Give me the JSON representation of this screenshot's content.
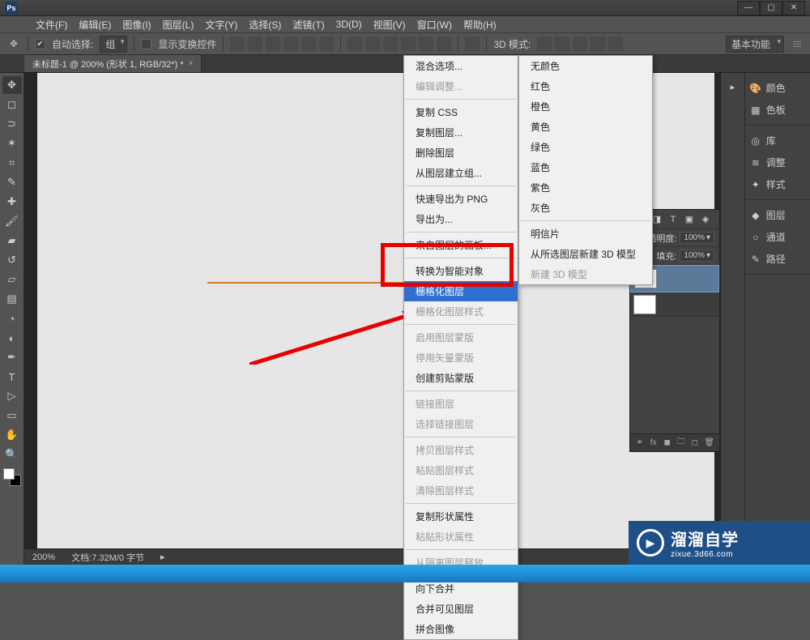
{
  "window": {
    "app_short": "Ps",
    "minimize": "—",
    "maximize": "▢",
    "close": "✕"
  },
  "menu": [
    "文件(F)",
    "编辑(E)",
    "图像(I)",
    "图层(L)",
    "文字(Y)",
    "选择(S)",
    "滤镜(T)",
    "3D(D)",
    "视图(V)",
    "窗口(W)",
    "帮助(H)"
  ],
  "options": {
    "auto_select_label": "自动选择:",
    "group_select": "组",
    "show_transform": "显示变换控件",
    "mode3d_label": "3D 模式:",
    "workspace": "基本功能"
  },
  "doc_tab": {
    "title": "未标题-1 @ 200% (形状 1, RGB/32*) *",
    "close": "×"
  },
  "right_tabs": {
    "grp1": [
      {
        "icon": "🎨",
        "label": "颜色"
      },
      {
        "icon": "▦",
        "label": "色板"
      }
    ],
    "grp2": [
      {
        "icon": "◎",
        "label": "库"
      },
      {
        "icon": "≋",
        "label": "调整"
      },
      {
        "icon": "✦",
        "label": "样式"
      }
    ],
    "grp3": [
      {
        "icon": "◆",
        "label": "图层"
      },
      {
        "icon": "○",
        "label": "通道"
      },
      {
        "icon": "✎",
        "label": "路径"
      }
    ]
  },
  "layers_panel": {
    "icons": [
      "◧",
      "◨",
      "T",
      "▣",
      "◈"
    ],
    "opacity_label": "不透明度:",
    "opacity_value": "100%",
    "fill_label": "填充:",
    "fill_value": "100%"
  },
  "status": {
    "zoom": "200%",
    "docinfo": "文档:7.32M/0 字节"
  },
  "context_menu": [
    {
      "t": "混合选项...",
      "d": false
    },
    {
      "t": "编辑调整...",
      "d": true
    },
    {
      "sep": true
    },
    {
      "t": "复制 CSS",
      "d": false
    },
    {
      "t": "复制图层...",
      "d": false
    },
    {
      "t": "删除图层",
      "d": false
    },
    {
      "t": "从图层建立组...",
      "d": false
    },
    {
      "sep": true
    },
    {
      "t": "快速导出为 PNG",
      "d": false
    },
    {
      "t": "导出为...",
      "d": false
    },
    {
      "sep": true
    },
    {
      "t": "来自图层的画板...",
      "d": false
    },
    {
      "sep": true
    },
    {
      "t": "转换为智能对象",
      "d": false
    },
    {
      "t": "栅格化图层",
      "d": false,
      "hl": true
    },
    {
      "t": "栅格化图层样式",
      "d": true
    },
    {
      "sep": true
    },
    {
      "t": "启用图层蒙版",
      "d": true
    },
    {
      "t": "停用矢量蒙版",
      "d": true
    },
    {
      "t": "创建剪贴蒙版",
      "d": false
    },
    {
      "sep": true
    },
    {
      "t": "链接图层",
      "d": true
    },
    {
      "t": "选择链接图层",
      "d": true
    },
    {
      "sep": true
    },
    {
      "t": "拷贝图层样式",
      "d": true
    },
    {
      "t": "粘贴图层样式",
      "d": true
    },
    {
      "t": "清除图层样式",
      "d": true
    },
    {
      "sep": true
    },
    {
      "t": "复制形状属性",
      "d": false
    },
    {
      "t": "粘贴形状属性",
      "d": true
    },
    {
      "sep": true
    },
    {
      "t": "从隔离图层释放",
      "d": true
    },
    {
      "sep": true
    },
    {
      "t": "向下合并",
      "d": false
    },
    {
      "t": "合并可见图层",
      "d": false
    },
    {
      "t": "拼合图像",
      "d": false
    }
  ],
  "sub_menu": [
    {
      "t": "无颜色",
      "d": false
    },
    {
      "t": "红色",
      "d": false
    },
    {
      "t": "橙色",
      "d": false
    },
    {
      "t": "黄色",
      "d": false
    },
    {
      "t": "绿色",
      "d": false
    },
    {
      "t": "蓝色",
      "d": false
    },
    {
      "t": "紫色",
      "d": false
    },
    {
      "t": "灰色",
      "d": false
    },
    {
      "sep": true
    },
    {
      "t": "明信片",
      "d": false
    },
    {
      "t": "从所选图层新建 3D 模型",
      "d": false
    },
    {
      "t": "新建 3D 模型",
      "d": true
    }
  ],
  "watermark": {
    "big": "溜溜自学",
    "sm": "zixue.3d66.com"
  }
}
